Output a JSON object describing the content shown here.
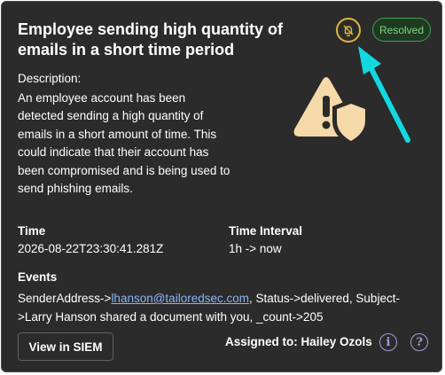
{
  "alert": {
    "title": "Employee sending high quantity of emails in a short time period",
    "status_badge": "Resolved",
    "description_label": "Description:",
    "description": "An employee account has been detected sending a high quantity of emails in a short amount of time. This could indicate that their account has been compromised and is being used to send phishing emails."
  },
  "fields": {
    "time_label": "Time",
    "time_value": "2026-08-22T23:30:41.281Z",
    "interval_label": "Time Interval",
    "interval_value": "1h -> now",
    "events_label": "Events",
    "events_prefix": "SenderAddress->",
    "events_email": "lhanson@tailoredsec.com",
    "events_suffix": ", Status->delivered, Subject->Larry Hanson shared a document with you, _count->205"
  },
  "footer": {
    "siem_button_label": "View in SIEM",
    "assigned_label": "Assigned to: Hailey Ozols",
    "info_icon_glyph": "i",
    "help_icon_glyph": "?"
  },
  "icons": {
    "bell": "bell-off-icon",
    "alert_graphic": "warning-shield-icon",
    "annotation": "cyan-arrow-annotation",
    "info": "info-icon",
    "help": "help-icon"
  },
  "colors": {
    "card_bg": "#2b2b2b",
    "bell_accent": "#e0b53a",
    "badge_green": "#3fa34d",
    "graphic_fill": "#f5d9a8",
    "arrow": "#12d9e0",
    "link": "#8ab4f8",
    "info_icon": "#a59bd6"
  }
}
